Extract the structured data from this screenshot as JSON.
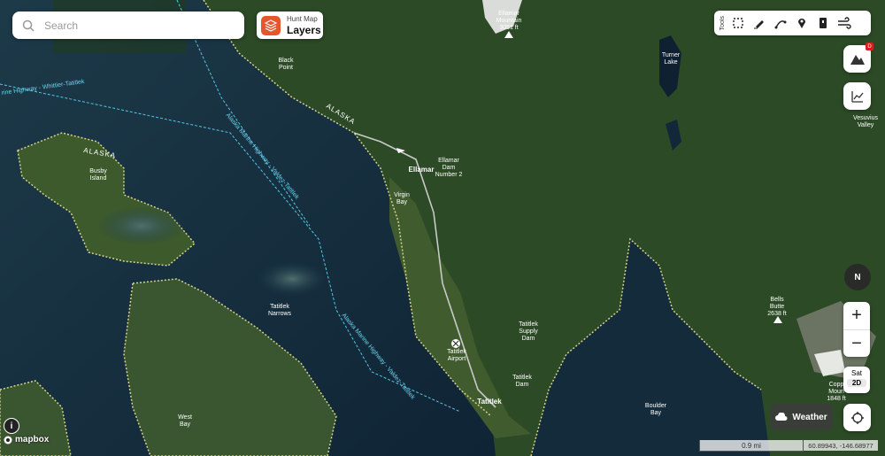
{
  "search": {
    "placeholder": "Search"
  },
  "layers": {
    "small": "Hunt Map",
    "big": "Layers"
  },
  "tools": {
    "label": "Tools",
    "icons": [
      "lasso-icon",
      "pen-icon",
      "route-icon",
      "pin-icon",
      "flag-icon",
      "wind-icon"
    ]
  },
  "controls": {
    "badge": "D",
    "compass": "N",
    "zoom_in": "+",
    "zoom_out": "−",
    "sat": "Sat",
    "dim": "2D",
    "weather": "Weather"
  },
  "footer": {
    "scale": "0.9 mi",
    "coords": "60.89943, -146.68977",
    "brand": "mapbox",
    "info": "i"
  },
  "labels": {
    "ellamar_mtn": "Ellamar\nMountain\n3051 ft",
    "turner_lake": "Turner\nLake",
    "black_point": "Black\nPoint",
    "alaska_road": "ALASKA",
    "alaska_island": "ALASKA",
    "whittier_ferry": "rine Highway - Whittier-Tatitlek",
    "marine_hwy1": "Alaska Marine Highway - Valdez-Tatitlek",
    "marine_hwy2": "Alaska Marine Highway - Valdez-Tatitlek",
    "busby": "Busby\nIsland",
    "ellamar": "Ellamar",
    "ellamar_dam": "Ellamar\nDam\nNumber 2",
    "virgin_bay": "Virgin\nBay",
    "vesuvius": "Vesuvius\nValley",
    "tatitlek_narrows": "Tatitlek\nNarrows",
    "bells_butte": "Bells\nButte\n2638 ft",
    "tatitlek_supply_dam": "Tatitlek\nSupply\nDam",
    "tatitlek_airport": "Tatitlek\nAirport",
    "tatitlek_dam": "Tatitlek\nDam",
    "tatitlek": "Tatitlek",
    "boulder_bay": "Boulder\nBay",
    "west_bay": "West\nBay",
    "copper_mtn": "Copp\nMoun\n1848 ft"
  }
}
